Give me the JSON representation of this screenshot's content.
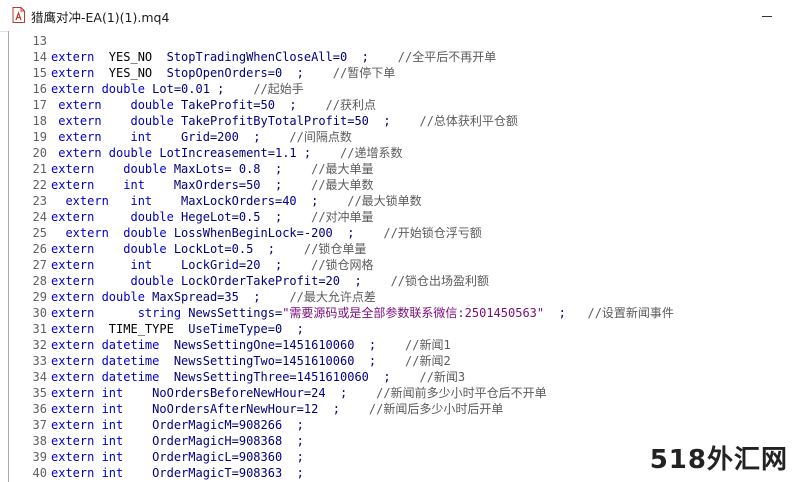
{
  "window": {
    "title": "猎鹰对冲-EA(1)(1).mq4",
    "icon": "mq4-file-icon"
  },
  "editor": {
    "lines": [
      {
        "n": "13",
        "segs": []
      },
      {
        "n": "14",
        "segs": [
          [
            "k",
            "extern  "
          ],
          [
            "b",
            "YES_NO  "
          ],
          [
            "v",
            "StopTradingWhenCloseAll=0  ;    "
          ],
          [
            "c",
            "//全平后不再开单"
          ]
        ]
      },
      {
        "n": "15",
        "segs": [
          [
            "k",
            "extern  "
          ],
          [
            "b",
            "YES_NO  "
          ],
          [
            "v",
            "StopOpenOrders=0  ;    "
          ],
          [
            "c",
            "//暂停下单"
          ]
        ]
      },
      {
        "n": "16",
        "segs": [
          [
            "k",
            "extern double "
          ],
          [
            "v",
            "Lot=0.01 ;    "
          ],
          [
            "c",
            "//起始手"
          ]
        ]
      },
      {
        "n": "17",
        "segs": [
          [
            "k",
            " extern    double "
          ],
          [
            "v",
            "TakeProfit=50  ;    "
          ],
          [
            "c",
            "//获利点"
          ]
        ]
      },
      {
        "n": "18",
        "segs": [
          [
            "k",
            " extern    double "
          ],
          [
            "v",
            "TakeProfitByTotalProfit=50  ;    "
          ],
          [
            "c",
            "//总体获利平仓额"
          ]
        ]
      },
      {
        "n": "19",
        "segs": [
          [
            "k",
            " extern    int    "
          ],
          [
            "v",
            "Grid=200  ;    "
          ],
          [
            "c",
            "//间隔点数"
          ]
        ]
      },
      {
        "n": "20",
        "segs": [
          [
            "k",
            " extern double "
          ],
          [
            "v",
            "LotIncreasement=1.1 ;    "
          ],
          [
            "c",
            "//递增系数"
          ]
        ]
      },
      {
        "n": "21",
        "segs": [
          [
            "k",
            "extern    double "
          ],
          [
            "v",
            "MaxLots= 0.8  ;    "
          ],
          [
            "c",
            "//最大单量"
          ]
        ]
      },
      {
        "n": "22",
        "segs": [
          [
            "k",
            "extern    int    "
          ],
          [
            "v",
            "MaxOrders=50  ;    "
          ],
          [
            "c",
            "//最大单数"
          ]
        ]
      },
      {
        "n": "23",
        "segs": [
          [
            "k",
            "  extern   int    "
          ],
          [
            "v",
            "MaxLockOrders=40  ;    "
          ],
          [
            "c",
            "//最大锁单数"
          ]
        ]
      },
      {
        "n": "24",
        "segs": [
          [
            "k",
            "extern     double "
          ],
          [
            "v",
            "HegeLot=0.5  ;    "
          ],
          [
            "c",
            "//对冲单量"
          ]
        ]
      },
      {
        "n": "25",
        "segs": [
          [
            "k",
            "  extern  double "
          ],
          [
            "v",
            "LossWhenBeginLock=-200  ;    "
          ],
          [
            "c",
            "//开始锁仓浮亏额"
          ]
        ]
      },
      {
        "n": "26",
        "segs": [
          [
            "k",
            "extern    double "
          ],
          [
            "v",
            "LockLot=0.5  ;    "
          ],
          [
            "c",
            "//锁仓单量"
          ]
        ]
      },
      {
        "n": "27",
        "segs": [
          [
            "k",
            "extern     int    "
          ],
          [
            "v",
            "LockGrid=20  ;    "
          ],
          [
            "c",
            "//锁仓网格"
          ]
        ]
      },
      {
        "n": "28",
        "segs": [
          [
            "k",
            "extern     double "
          ],
          [
            "v",
            "LockOrderTakeProfit=20  ;    "
          ],
          [
            "c",
            "//锁仓出场盈利额"
          ]
        ]
      },
      {
        "n": "29",
        "segs": [
          [
            "k",
            "extern double "
          ],
          [
            "v",
            "MaxSpread=35  ;    "
          ],
          [
            "c",
            "//最大允许点差"
          ]
        ]
      },
      {
        "n": "30",
        "segs": [
          [
            "k",
            "extern      string "
          ],
          [
            "v",
            "NewsSettings="
          ],
          [
            "s",
            "\"需要源码或是全部参数联系微信:2501450563\""
          ],
          [
            "v",
            "  ;   "
          ],
          [
            "c",
            "//设置新闻事件"
          ]
        ]
      },
      {
        "n": "31",
        "segs": [
          [
            "k",
            "extern  "
          ],
          [
            "b",
            "TIME_TYPE  "
          ],
          [
            "v",
            "UseTimeType=0  ;"
          ]
        ]
      },
      {
        "n": "32",
        "segs": [
          [
            "k",
            "extern datetime  "
          ],
          [
            "v",
            "NewsSettingOne=1451610060  ;    "
          ],
          [
            "c",
            "//新闻1"
          ]
        ]
      },
      {
        "n": "33",
        "segs": [
          [
            "k",
            "extern datetime  "
          ],
          [
            "v",
            "NewsSettingTwo=1451610060  ;    "
          ],
          [
            "c",
            "//新闻2"
          ]
        ]
      },
      {
        "n": "34",
        "segs": [
          [
            "k",
            "extern datetime  "
          ],
          [
            "v",
            "NewsSettingThree=1451610060  ;    "
          ],
          [
            "c",
            "//新闻3"
          ]
        ]
      },
      {
        "n": "35",
        "segs": [
          [
            "k",
            "extern int    "
          ],
          [
            "v",
            "NoOrdersBeforeNewHour=24  ;    "
          ],
          [
            "c",
            "//新闻前多少小时平仓后不开单"
          ]
        ]
      },
      {
        "n": "36",
        "segs": [
          [
            "k",
            "extern int    "
          ],
          [
            "v",
            "NoOrdersAfterNewHour=12  ;    "
          ],
          [
            "c",
            "//新闻后多少小时后开单"
          ]
        ]
      },
      {
        "n": "37",
        "segs": [
          [
            "k",
            "extern int    "
          ],
          [
            "v",
            "OrderMagicM=908266  ;"
          ]
        ]
      },
      {
        "n": "38",
        "segs": [
          [
            "k",
            "extern int    "
          ],
          [
            "v",
            "OrderMagicH=908368  ;"
          ]
        ]
      },
      {
        "n": "39",
        "segs": [
          [
            "k",
            "extern int    "
          ],
          [
            "v",
            "OrderMagicL=908360  ;"
          ]
        ]
      },
      {
        "n": "40",
        "segs": [
          [
            "k",
            "extern int    "
          ],
          [
            "v",
            "OrderMagicT=908363  ;"
          ]
        ]
      }
    ]
  },
  "watermark": "518外汇网"
}
